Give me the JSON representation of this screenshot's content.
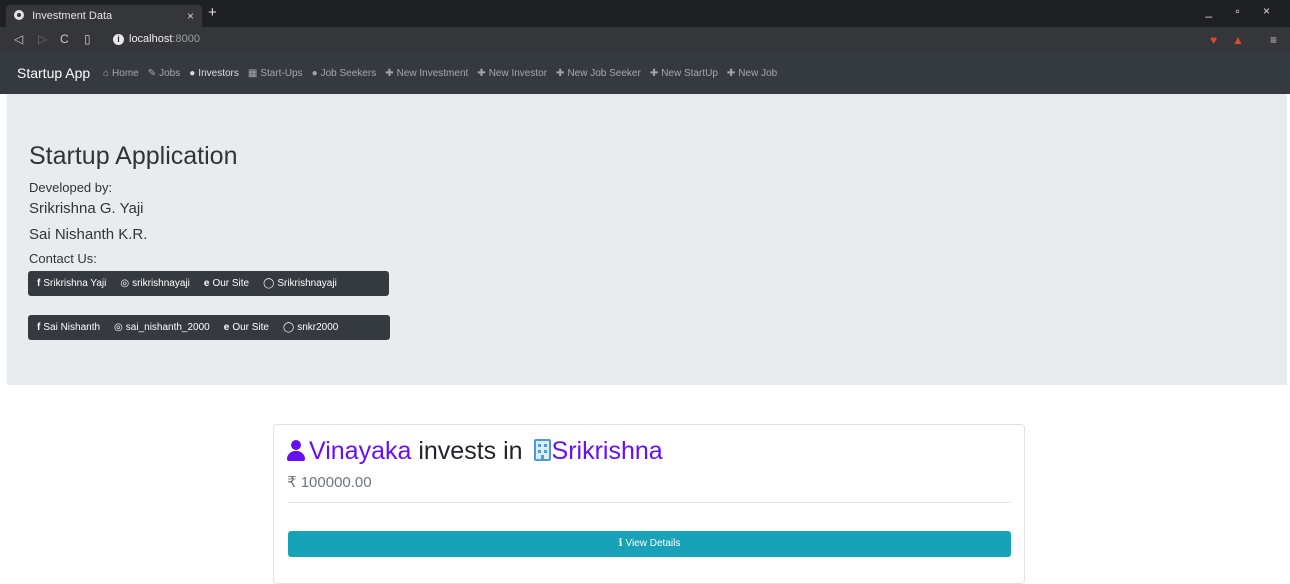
{
  "browser": {
    "tab_title": "Investment Data",
    "tab_close": "×",
    "new_tab": "+",
    "url_host": "localhost",
    "url_port": ":8000",
    "window_controls": "_ ▫ ×"
  },
  "navbar": {
    "brand": "Startup App",
    "links": [
      {
        "label": "Home",
        "icon": "home-icon",
        "glyph": "⌂"
      },
      {
        "label": "Jobs",
        "icon": "wrench-icon",
        "glyph": "✎"
      },
      {
        "label": "Investors",
        "icon": "user-icon",
        "glyph": "●"
      },
      {
        "label": "Start-Ups",
        "icon": "building-icon",
        "glyph": "▦"
      },
      {
        "label": "Job Seekers",
        "icon": "user-icon",
        "glyph": "●"
      },
      {
        "label": "New Investment",
        "icon": "plus-icon",
        "glyph": "✚"
      },
      {
        "label": "New Investor",
        "icon": "plus-icon",
        "glyph": "✚"
      },
      {
        "label": "New Job Seeker",
        "icon": "plus-icon",
        "glyph": "✚"
      },
      {
        "label": "New StartUp",
        "icon": "plus-icon",
        "glyph": "✚"
      },
      {
        "label": "New Job",
        "icon": "plus-icon",
        "glyph": "✚"
      }
    ]
  },
  "jumbotron": {
    "title": "Startup Application",
    "developed_by": "Developed by:",
    "developer_1": "Srikrishna G. Yaji",
    "developer_2": "Sai Nishanth K.R.",
    "contact_label": "Contact Us:",
    "contacts_1": [
      {
        "label": "Srikrishna Yaji",
        "icon": "facebook-icon",
        "glyph": "f"
      },
      {
        "label": "srikrishnayaji",
        "icon": "instagram-icon",
        "glyph": "◎"
      },
      {
        "label": "Our Site",
        "icon": "globe-icon",
        "glyph": "e"
      },
      {
        "label": "Srikrishnayaji",
        "icon": "github-icon",
        "glyph": "◯"
      }
    ],
    "contacts_2": [
      {
        "label": "Sai Nishanth",
        "icon": "facebook-icon",
        "glyph": "f"
      },
      {
        "label": "sai_nishanth_2000",
        "icon": "instagram-icon",
        "glyph": "◎"
      },
      {
        "label": "Our Site",
        "icon": "globe-icon",
        "glyph": "e"
      },
      {
        "label": "snkr2000",
        "icon": "github-icon",
        "glyph": "◯"
      }
    ]
  },
  "investment": {
    "investor": "Vinayaka",
    "connector": " invests in ",
    "startup": "Srikrishna",
    "amount": "₹ 100000.00",
    "button_icon": "i",
    "button_label": "View Details"
  },
  "colors": {
    "navbar_bg": "#343a40",
    "jumbotron_bg": "#e9ecef",
    "link": "#6610f2",
    "info_button": "#17a2b8"
  }
}
